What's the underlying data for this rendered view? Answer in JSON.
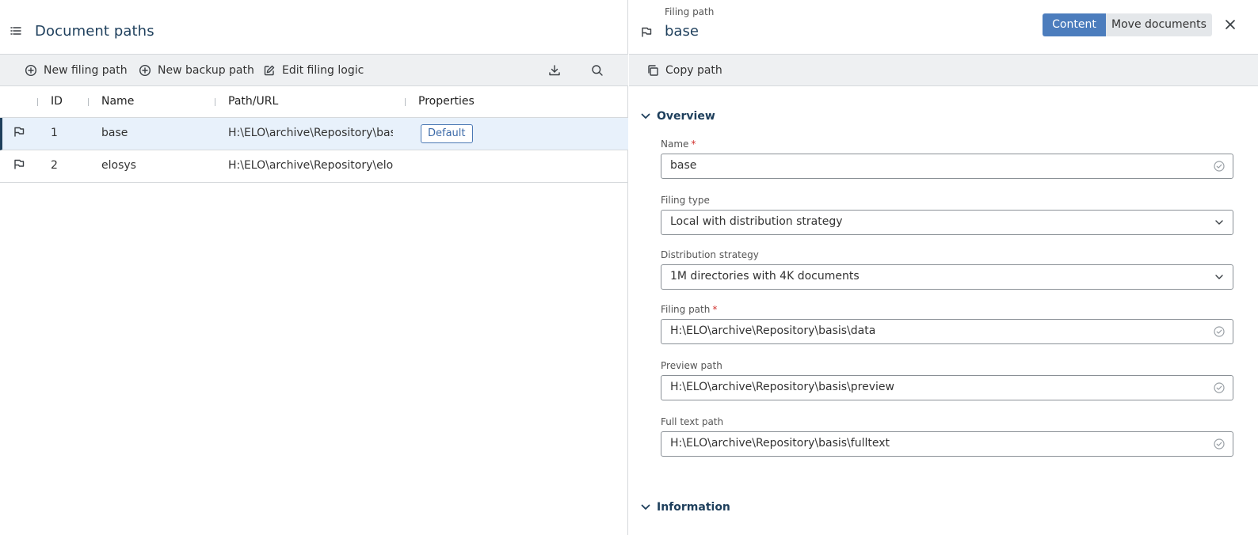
{
  "header": {
    "title": "Document paths"
  },
  "toolbar": {
    "new_filing_path": "New filing path",
    "new_backup_path": "New backup path",
    "edit_filing_logic": "Edit filing logic"
  },
  "table": {
    "columns": [
      "ID",
      "Name",
      "Path/URL",
      "Properties"
    ],
    "rows": [
      {
        "id": "1",
        "name": "base",
        "path": "H:\\ELO\\archive\\Repository\\basis\\data",
        "badge": "Default",
        "selected": true
      },
      {
        "id": "2",
        "name": "elosys",
        "path": "H:\\ELO\\archive\\Repository\\elosys\\data",
        "badge": "",
        "selected": false
      }
    ]
  },
  "detail": {
    "kind": "Filing path",
    "title": "base",
    "tab_content": "Content",
    "tab_move": "Move documents",
    "copy_path": "Copy path",
    "section_overview": "Overview",
    "section_information": "Information",
    "fields": {
      "name": {
        "label": "Name",
        "required": "*",
        "value": "base"
      },
      "filing_type": {
        "label": "Filing type",
        "value": "Local with distribution strategy"
      },
      "distribution_strategy": {
        "label": "Distribution strategy",
        "value": "1M directories with 4K documents"
      },
      "filing_path": {
        "label": "Filing path",
        "required": "*",
        "value": "H:\\ELO\\archive\\Repository\\basis\\data"
      },
      "preview_path": {
        "label": "Preview path",
        "value": "H:\\ELO\\archive\\Repository\\basis\\preview"
      },
      "full_text_path": {
        "label": "Full text path",
        "value": "H:\\ELO\\archive\\Repository\\basis\\fulltext"
      }
    }
  },
  "icons": {
    "menu": "list-menu-icon",
    "path": "filing-path-icon",
    "add": "plus-circle-icon",
    "edit": "edit-icon",
    "download": "download-icon",
    "search": "search-icon",
    "copy": "copy-icon",
    "close": "close-icon",
    "valid": "check-circle-icon",
    "chevron": "chevron-down-icon"
  },
  "colors": {
    "accent": "#4c7dbd",
    "title": "#1e3f5c",
    "selected_row": "#e8f1fb",
    "toolbar_bg": "#eef0f2",
    "required": "#d0312d"
  }
}
